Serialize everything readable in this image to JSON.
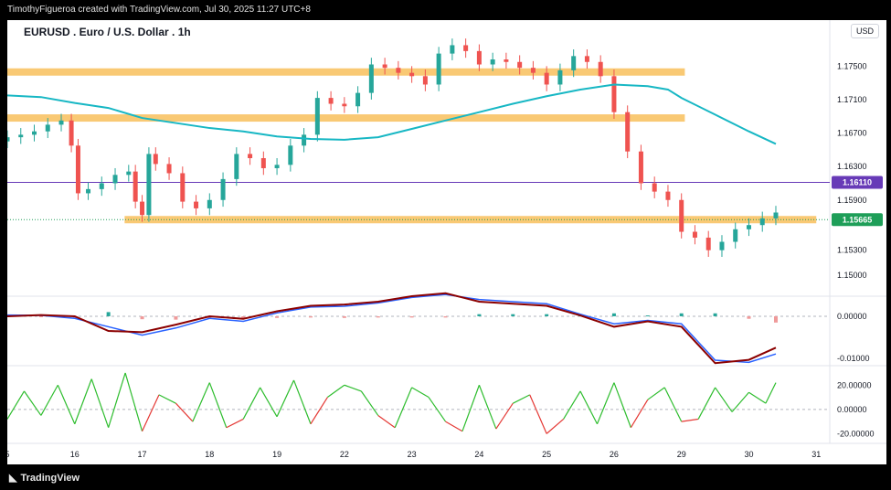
{
  "header": {
    "created_by": "TimothyFigueroa created with TradingView.com, Jul 30, 2025 11:27 UTC+8"
  },
  "footer": {
    "logo_text": "TradingView"
  },
  "chart_data": [
    {
      "type": "line",
      "panel": "price",
      "title": "EURUSD . Euro / U.S. Dollar . 1h",
      "currency": "USD",
      "y_ticks": [
        "1.17500",
        "1.17100",
        "1.16700",
        "1.16300",
        "1.15900",
        "1.15300",
        "1.15000"
      ],
      "y_tick_values": [
        1.175,
        1.171,
        1.167,
        1.163,
        1.159,
        1.153,
        1.15
      ],
      "ylim": [
        1.1475,
        1.1805
      ],
      "x_ticks": [
        "5",
        "16",
        "17",
        "18",
        "19",
        "22",
        "23",
        "24",
        "25",
        "26",
        "29",
        "30",
        "31"
      ],
      "x_tick_positions": [
        0,
        1,
        2,
        3,
        4,
        5,
        6,
        7,
        8,
        9,
        10,
        11,
        12
      ],
      "xlim": [
        0,
        12.2
      ],
      "series": [
        {
          "kind": "candles",
          "color_up": "#26a69a",
          "color_down": "#ef5350",
          "x": [
            0,
            0.2,
            0.4,
            0.6,
            0.8,
            0.95,
            1.05,
            1.2,
            1.4,
            1.6,
            1.8,
            1.9,
            2.0,
            2.1,
            2.2,
            2.4,
            2.6,
            2.8,
            3.0,
            3.2,
            3.4,
            3.6,
            3.8,
            4.0,
            4.2,
            4.4,
            4.6,
            4.8,
            5.0,
            5.2,
            5.4,
            5.6,
            5.8,
            6.0,
            6.2,
            6.4,
            6.6,
            6.8,
            7.0,
            7.2,
            7.4,
            7.6,
            7.8,
            8.0,
            8.2,
            8.4,
            8.6,
            8.8,
            9.0,
            9.2,
            9.4,
            9.6,
            9.8,
            10.0,
            10.2,
            10.4,
            10.6,
            10.8,
            11.0,
            11.2,
            11.4
          ],
          "close": [
            1.1665,
            1.1668,
            1.1672,
            1.168,
            1.1685,
            1.1655,
            1.1598,
            1.1603,
            1.161,
            1.162,
            1.1624,
            1.1588,
            1.1572,
            1.1645,
            1.1633,
            1.1622,
            1.1588,
            1.158,
            1.159,
            1.1615,
            1.1645,
            1.164,
            1.1628,
            1.1632,
            1.1655,
            1.1668,
            1.1712,
            1.1705,
            1.1702,
            1.1718,
            1.1752,
            1.1748,
            1.1742,
            1.1738,
            1.1728,
            1.1765,
            1.1775,
            1.1768,
            1.1752,
            1.1758,
            1.1755,
            1.1748,
            1.1742,
            1.1728,
            1.1745,
            1.1762,
            1.1755,
            1.1738,
            1.1695,
            1.1648,
            1.161,
            1.16,
            1.159,
            1.1552,
            1.1545,
            1.153,
            1.154,
            1.1555,
            1.156,
            1.1568,
            1.1575
          ]
        },
        {
          "name": "",
          "kind": "moving-average",
          "color": "#17b7c4",
          "x": [
            0,
            0.5,
            1.0,
            1.5,
            2.0,
            2.5,
            3.0,
            3.5,
            4.0,
            4.5,
            5.0,
            5.5,
            6.0,
            6.5,
            7.0,
            7.5,
            8.0,
            8.5,
            9.0,
            9.5,
            9.8,
            10.0,
            10.5,
            11.0,
            11.4
          ],
          "values": [
            1.1715,
            1.1713,
            1.1706,
            1.17,
            1.1688,
            1.1682,
            1.1676,
            1.1672,
            1.1666,
            1.1663,
            1.1662,
            1.1665,
            1.1675,
            1.1685,
            1.1695,
            1.1705,
            1.1714,
            1.1722,
            1.1728,
            1.1726,
            1.1722,
            1.1712,
            1.1692,
            1.1672,
            1.1657
          ]
        }
      ],
      "horizontal_lines": [
        {
          "price": 1.1611,
          "label": "1.16110",
          "color": "#673ab7",
          "style": "line"
        },
        {
          "price": 1.15665,
          "label": "1.15665",
          "color": "#1e9e58",
          "style": "dotted"
        }
      ],
      "zones": [
        {
          "price": 1.1743,
          "color": "#f9c974",
          "x_start": 0,
          "x_end": 10.05
        },
        {
          "price": 1.1688,
          "color": "#f9c974",
          "x_start": 0,
          "x_end": 10.05
        },
        {
          "price": 1.15665,
          "color": "#f9c974",
          "x_start": 1.74,
          "x_end": 12.0
        }
      ]
    },
    {
      "type": "line",
      "panel": "macd",
      "y_ticks": [
        "0.00000",
        "-0.01000"
      ],
      "y_tick_values": [
        0,
        -0.01
      ],
      "ylim": [
        -0.0118,
        0.0048
      ],
      "series": [
        {
          "name": "",
          "color": "#2962ff",
          "x": [
            0,
            0.5,
            1.0,
            1.5,
            2.0,
            2.5,
            3.0,
            3.5,
            4.0,
            4.5,
            5.0,
            5.5,
            6.0,
            6.5,
            7.0,
            7.5,
            8.0,
            8.5,
            9.0,
            9.5,
            10.0,
            10.5,
            11.0,
            11.4
          ],
          "values": [
            0.0003,
            0.0002,
            -0.0005,
            -0.0025,
            -0.0045,
            -0.0028,
            -0.0005,
            -0.0012,
            0.0008,
            0.0022,
            0.0024,
            0.0032,
            0.0045,
            0.0052,
            0.004,
            0.0035,
            0.003,
            0.0005,
            -0.0018,
            -0.001,
            -0.0018,
            -0.0105,
            -0.011,
            -0.009
          ]
        },
        {
          "name": "",
          "color": "#8b0000",
          "x": [
            0,
            0.5,
            1.0,
            1.5,
            2.0,
            2.5,
            3.0,
            3.5,
            4.0,
            4.5,
            5.0,
            5.5,
            6.0,
            6.5,
            7.0,
            7.5,
            8.0,
            8.5,
            9.0,
            9.5,
            10.0,
            10.5,
            11.0,
            11.4
          ],
          "values": [
            0.0,
            0.0003,
            0.0,
            -0.0035,
            -0.0038,
            -0.002,
            0.0,
            -0.0006,
            0.0012,
            0.0025,
            0.0028,
            0.0035,
            0.0048,
            0.0055,
            0.0035,
            0.003,
            0.0025,
            0.0002,
            -0.0025,
            -0.0012,
            -0.0025,
            -0.0112,
            -0.0104,
            -0.0075
          ]
        },
        {
          "name": "",
          "kind": "histogram",
          "x": [
            0,
            0.5,
            1.0,
            1.5,
            2.0,
            2.5,
            3.0,
            3.5,
            4.0,
            4.5,
            5.0,
            5.5,
            6.0,
            6.5,
            7.0,
            7.5,
            8.0,
            8.5,
            9.0,
            9.5,
            10.0,
            10.5,
            11.0,
            11.4
          ],
          "values": [
            0.0003,
            -0.0001,
            -0.0005,
            0.001,
            -0.0007,
            -0.0008,
            -0.0005,
            -0.0006,
            -0.0004,
            -0.0003,
            -0.0004,
            -0.0003,
            -0.0003,
            -0.0003,
            0.0005,
            0.0005,
            0.0005,
            0.0003,
            0.0007,
            0.0002,
            0.0007,
            0.0007,
            -0.0006,
            -0.0015
          ]
        }
      ]
    },
    {
      "type": "line",
      "panel": "oscillator",
      "y_ticks": [
        "20.00000",
        "0.00000",
        "-20.00000"
      ],
      "y_tick_values": [
        20,
        0,
        -20
      ],
      "ylim": [
        -28,
        36
      ],
      "series": [
        {
          "name": "",
          "color_above": "#2ebd2e",
          "color_below": "#e53935",
          "x": [
            0,
            0.25,
            0.5,
            0.75,
            1.0,
            1.25,
            1.5,
            1.75,
            2.0,
            2.25,
            2.5,
            2.75,
            3.0,
            3.25,
            3.5,
            3.75,
            4.0,
            4.25,
            4.5,
            4.75,
            5.0,
            5.25,
            5.5,
            5.75,
            6.0,
            6.25,
            6.5,
            6.75,
            7.0,
            7.25,
            7.5,
            7.75,
            8.0,
            8.25,
            8.5,
            8.75,
            9.0,
            9.25,
            9.5,
            9.75,
            10.0,
            10.25,
            10.5,
            10.75,
            11.0,
            11.25,
            11.4
          ],
          "values": [
            -8,
            15,
            -5,
            20,
            -12,
            25,
            -15,
            30,
            -18,
            12,
            5,
            -10,
            22,
            -15,
            -8,
            18,
            -6,
            24,
            -12,
            10,
            20,
            15,
            -5,
            -15,
            18,
            10,
            -10,
            -18,
            20,
            -16,
            5,
            12,
            -20,
            -8,
            15,
            -12,
            22,
            -15,
            8,
            18,
            -10,
            -8,
            18,
            -2,
            14,
            5,
            22
          ]
        }
      ]
    }
  ]
}
